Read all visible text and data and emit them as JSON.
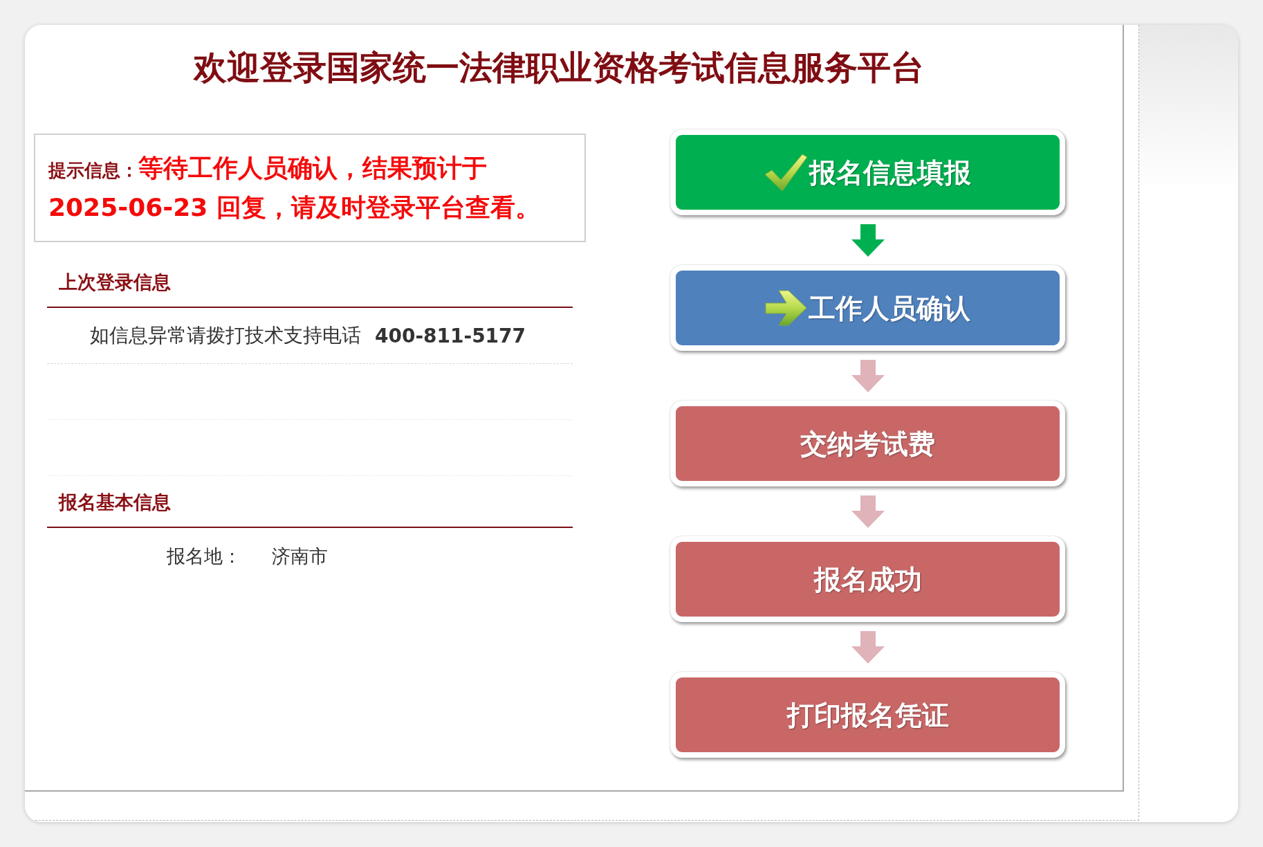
{
  "title": "欢迎登录国家统一法律职业资格考试信息服务平台",
  "notice": {
    "label": "提示信息：",
    "message": "等待工作人员确认，结果预计于2025-06-23 回复，请及时登录平台查看。"
  },
  "last_login": {
    "heading": "上次登录信息",
    "support": {
      "text": "如信息异常请拨打技术支持电话",
      "phone": "400-811-5177"
    }
  },
  "registration": {
    "heading": "报名基本信息",
    "fields": [
      {
        "label": "报名地：",
        "value": "济南市"
      }
    ]
  },
  "steps": [
    {
      "label": "报名信息填报",
      "done": true,
      "current": false
    },
    {
      "label": "工作人员确认",
      "done": false,
      "current": true
    },
    {
      "label": "交纳考试费",
      "done": false,
      "current": false
    },
    {
      "label": "报名成功",
      "done": false,
      "current": false
    },
    {
      "label": "打印报名凭证",
      "done": false,
      "current": false
    }
  ]
}
